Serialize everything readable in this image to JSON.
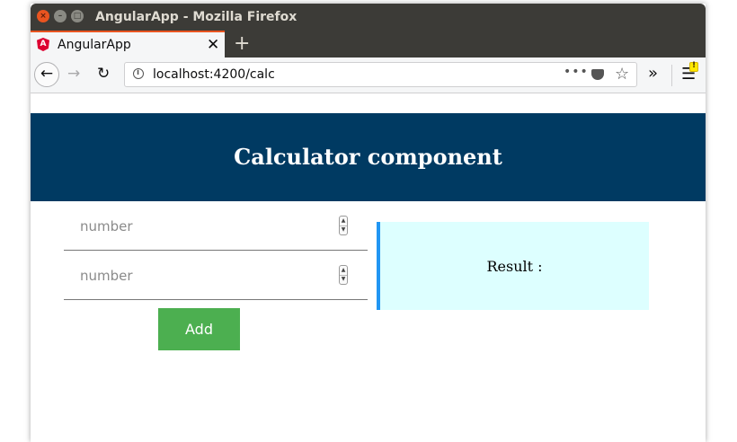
{
  "window": {
    "title": "AngularApp - Mozilla Firefox",
    "close_glyph": "×",
    "minimize_glyph": "–",
    "maximize_glyph": "□"
  },
  "tab": {
    "title": "AngularApp",
    "favicon_letter": "A",
    "close_glyph": "✕",
    "new_tab_glyph": "+"
  },
  "navbar": {
    "back_glyph": "←",
    "forward_glyph": "→",
    "reload_glyph": "↻",
    "info_glyph": "i",
    "url": "localhost:4200/calc",
    "page_actions_glyph": "•••",
    "pocket_glyph": "˅",
    "bookmark_glyph": "☆",
    "overflow_glyph": "»",
    "menu_glyph": "☰",
    "warning_glyph": "!"
  },
  "page": {
    "header_title": "Calculator component",
    "input1_placeholder": "number",
    "input2_placeholder": "number",
    "spinner_up": "▲",
    "spinner_down": "▼",
    "add_label": "Add",
    "result_label": "Result :"
  },
  "colors": {
    "header_bg": "#003a62",
    "add_button_bg": "#4caf50",
    "result_bg": "#ddffff",
    "result_border": "#2196f3",
    "tab_accent": "#e95420"
  }
}
